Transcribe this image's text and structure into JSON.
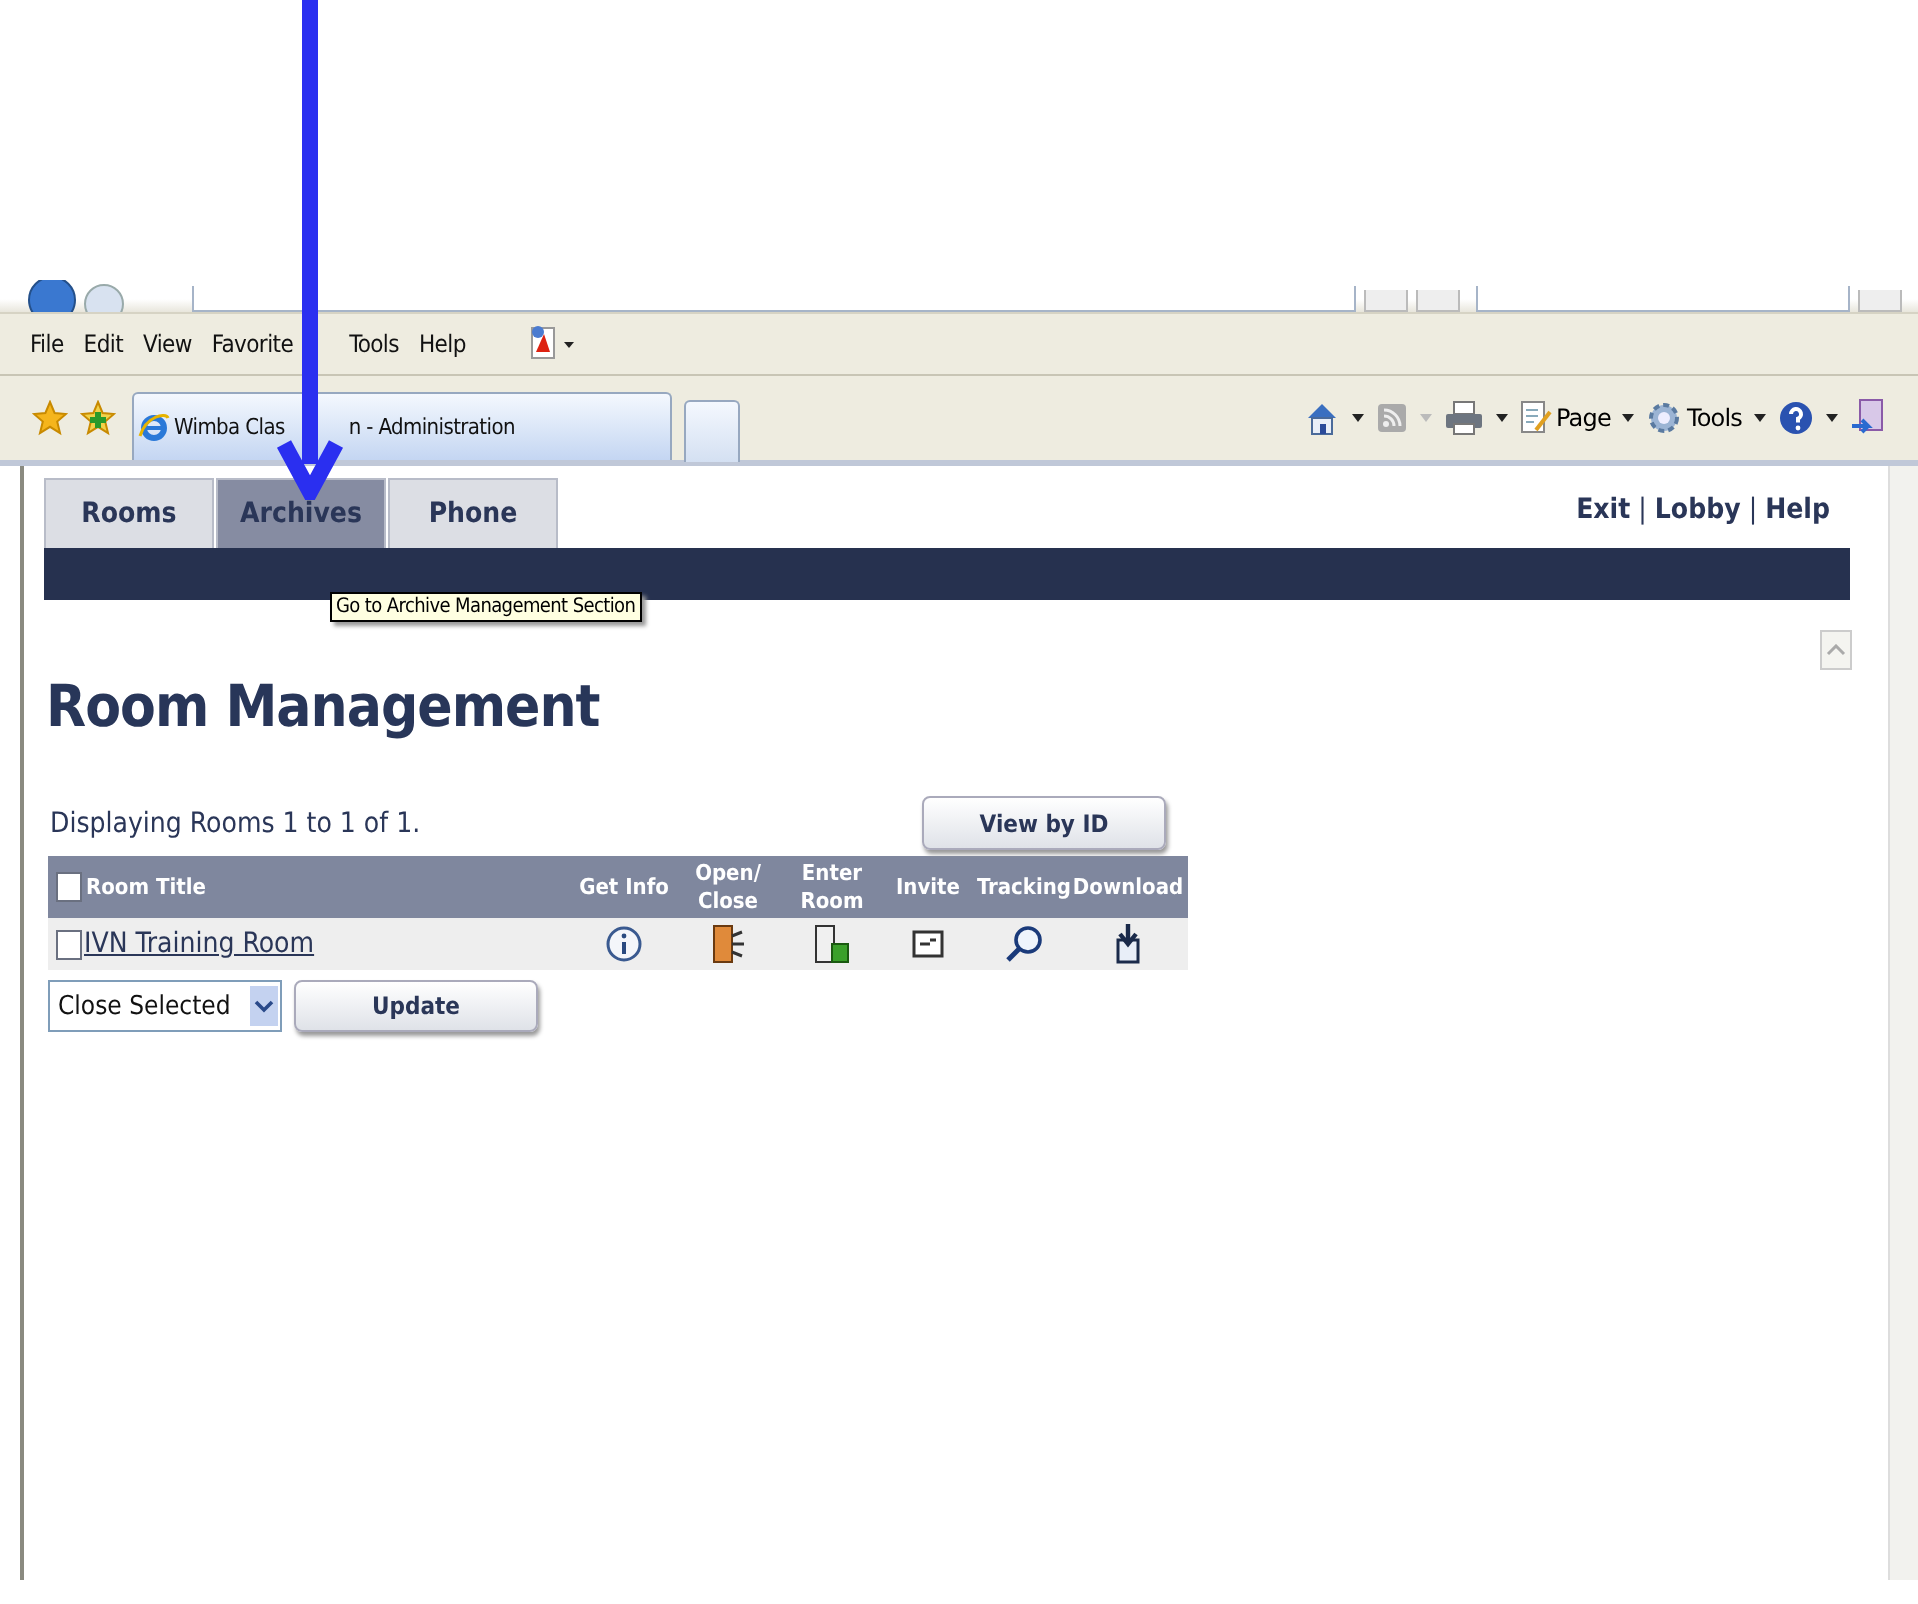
{
  "browser": {
    "menu": [
      "File",
      "Edit",
      "View",
      "Favorite",
      "Tools",
      "Help"
    ],
    "tab": {
      "title_parts": [
        "Wimba Clas",
        "n - Administration"
      ]
    },
    "command_bar": [
      "Page",
      "Tools"
    ]
  },
  "app": {
    "tabs": [
      {
        "label": "Rooms",
        "selected": false
      },
      {
        "label": "Archives",
        "selected": true
      },
      {
        "label": "Phone",
        "selected": false
      }
    ],
    "links": [
      "Exit",
      "Lobby",
      "Help"
    ],
    "link_separators": [
      "|",
      "|"
    ],
    "tooltip": "Go to Archive Management Section",
    "heading": "Room Management",
    "summary": "Displaying Rooms 1 to 1 of 1.",
    "view_button": "View by ID",
    "table": {
      "header_checked": false,
      "columns": [
        "Room Title",
        "Get Info",
        "Open/ Close",
        "Enter Room",
        "Invite",
        "Tracking",
        "Download"
      ],
      "rows": [
        {
          "title": "IVN Training Room",
          "checked": false
        }
      ]
    },
    "action_select": "Close Selected",
    "update_button": "Update"
  }
}
